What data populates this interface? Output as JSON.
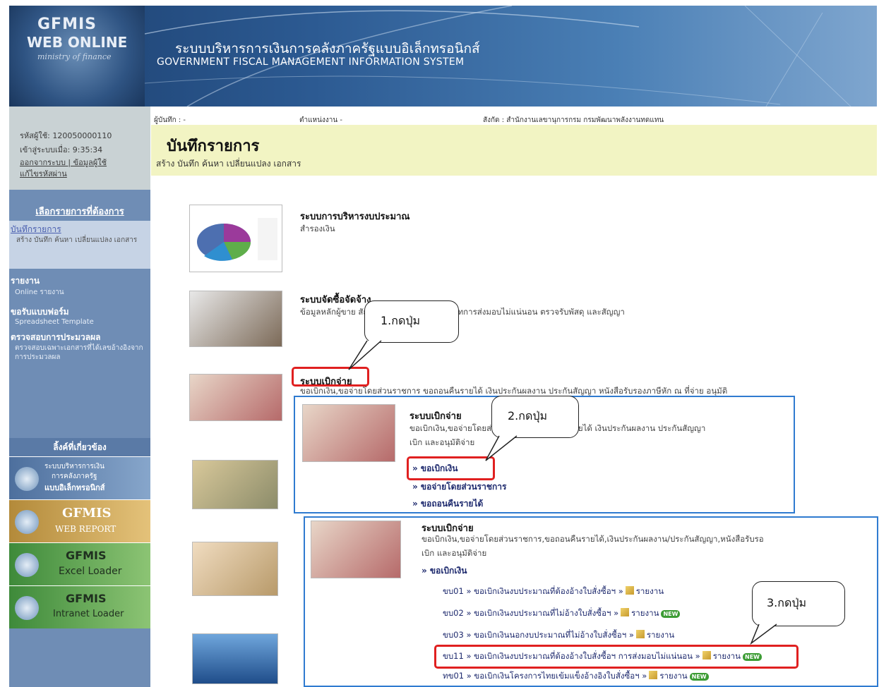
{
  "header": {
    "logo_line1": "GFMIS",
    "logo_line2": "WEB ONLINE",
    "logo_line3": "ministry of finance",
    "title_th": "ระบบบริหารการเงินการคลังภาครัฐแบบอิเล็กทรอนิกส์",
    "title_en": "GOVERNMENT FISCAL MANAGEMENT INFORMATION SYSTEM"
  },
  "infobar": {
    "recorder": "ผู้บันทึก : -",
    "position": "ตำแหน่งงาน  -",
    "affiliation": "สังกัด : สำนักงานเลขานุการกรม กรมพัฒนาพลังงานทดแทน"
  },
  "sidebar": {
    "user_code": "รหัสผู้ใช้: 120050000110",
    "login_time": "เข้าสู่ระบบเมื่อ: 9:35:34",
    "logout": "ออกจากระบบ | ข้อมูลผู้ใช้",
    "change_password": "แก้ไขรหัสผ่าน",
    "menu_head": "เลือกรายการที่ต้องการ",
    "menu_sel_title": "บันทึกรายการ",
    "menu_sel_desc": "สร้าง บันทึก ค้นหา เปลี่ยนแปลง เอกสาร",
    "reports_title": "รายงาน",
    "reports_sub": "Online รายงาน",
    "forms_title": "ขอรับแบบฟอร์ม",
    "forms_sub": "Spreadsheet Template",
    "check_title": "ตรวจสอบการประมวลผล",
    "check_sub": "ตรวจสอบเฉพาะเอกสารที่ได้เลขอ้างอิงจากการประมวลผล",
    "links_head": "ลิ้งค์ที่เกี่ยวข้อง",
    "banner1_line1": "ระบบบริหารการเงิน",
    "banner1_line2": "การคลังภาครัฐ",
    "banner1_line3": "แบบอิเล็กทรอนิกส์",
    "banner2_line1": "GFMIS",
    "banner2_line2": "WEB REPORT",
    "banner3_line1": "GFMIS",
    "banner3_line2": "Excel Loader",
    "banner4_line1": "GFMIS",
    "banner4_line2": "Intranet Loader"
  },
  "content": {
    "page_title": "บันทึกรายการ",
    "page_sub": "สร้าง บันทึก ค้นหา เปลี่ยนแปลง เอกสาร",
    "tile1_title": "ระบบการบริหารงบประมาณ",
    "tile1_desc": "สำรองเงิน",
    "tile2_title": "ระบบจัดซื้อจัดจ้าง",
    "tile2_desc": "ข้อมูลหลักผู้ขาย สัญญา จัดซื้อ จ้าง เช่าประเภทการส่งมอบไม่แน่นอน ตรวจรับพัสดุ และสัญญา",
    "tile3_title": "ระบบเบิกจ่าย",
    "tile3_desc": "ขอเบิกเงิน,ขอจ่ายโดยส่วนราชการ ขอถอนคืนรายได้ เงินประกันผลงาน ประกันสัญญา หนังสือรับรองภาษีหัก ณ ที่จ่าย อนุมัติ"
  },
  "panel1": {
    "title": "ระบบเบิกจ่าย",
    "desc1": "ขอเบิกเงิน,ขอจ่ายโดยส่วนราชการ ขอถอนคืนรายได้ เงินประกันผลงาน ประกันสัญญา",
    "desc2": "เบิก และอนุมัติจ่าย",
    "link1": "» ขอเบิกเงิน",
    "link2": "» ขอจ่ายโดยส่วนราชการ",
    "link3": "» ขอถอนคืนรายได้"
  },
  "panel2": {
    "title": "ระบบเบิกจ่าย",
    "desc1": "ขอเบิกเงิน,ขอจ่ายโดยส่วนราชการ,ขอถอนคืนรายได้,เงินประกันผลงาน/ประกันสัญญา,หนังสือรับรอ",
    "desc2": "เบิก และอนุมัติจ่าย",
    "section": "» ขอเบิกเงิน",
    "rows": [
      {
        "text": "ขบ01 » ขอเบิกเงินงบประมาณที่ต้องอ้างใบสั่งซื้อฯ »",
        "report": "รายงาน"
      },
      {
        "text": "ขบ02 » ขอเบิกเงินงบประมาณที่ไม่อ้างใบสั่งซื้อฯ »",
        "report": "รายงาน"
      },
      {
        "text": "ขบ03 » ขอเบิกเงินนอกงบประมาณที่ไม่อ้างใบสั่งซื้อฯ »",
        "report": "รายงาน"
      },
      {
        "text": "ขบ11 » ขอเบิกเงินงบประมาณที่ต้องอ้างใบสั่งซื้อฯ การส่งมอบไม่แน่นอน »",
        "report": "รายงาน"
      },
      {
        "text": "ทข01 » ขอเบิกเงินโครงการไทยเข้มแข็งอ้างอิงใบสั่งซื้อฯ »",
        "report": "รายงาน"
      }
    ],
    "new_badge": "NEW"
  },
  "callouts": {
    "c1": "1.กดปุ่ม",
    "c2": "2.กดปุ่ม",
    "c3": "3.กดปุ่ม"
  },
  "colors": {
    "header_dark": "#1c3f6e",
    "sidebar": "#6f8db5",
    "content_head": "#f2f4c3",
    "highlight": "#e02020",
    "panel_border": "#2f7bd0"
  }
}
